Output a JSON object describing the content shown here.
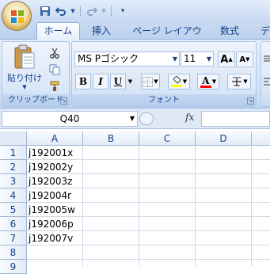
{
  "quick_access": {
    "save_icon": "save-icon",
    "undo_icon": "undo-icon",
    "redo_icon": "redo-icon"
  },
  "tabs": [
    {
      "label": "ホーム",
      "active": true
    },
    {
      "label": "挿入"
    },
    {
      "label": "ページ レイアウト"
    },
    {
      "label": "数式"
    },
    {
      "label": "デ"
    }
  ],
  "clipboard": {
    "paste_label": "貼り付け",
    "group_label": "クリップボード"
  },
  "font_group": {
    "font_name": "MS Pゴシック",
    "font_size": "11",
    "bold": "B",
    "italic": "I",
    "underline": "U",
    "font_color_letter": "A",
    "group_label": "フォント",
    "fill_color": "#ffff00",
    "font_color": "#ff0000"
  },
  "formula_bar": {
    "name_box": "Q40",
    "fx": "fx",
    "formula": ""
  },
  "sheet": {
    "columns": [
      "A",
      "B",
      "C",
      "D"
    ],
    "rows": [
      "1",
      "2",
      "3",
      "4",
      "5",
      "6",
      "7",
      "8",
      "9"
    ],
    "cells_a": [
      "j192001x",
      "j192002y",
      "j192003z",
      "j192004r",
      "j192005w",
      "j192006p",
      "j192007v",
      "",
      ""
    ]
  }
}
